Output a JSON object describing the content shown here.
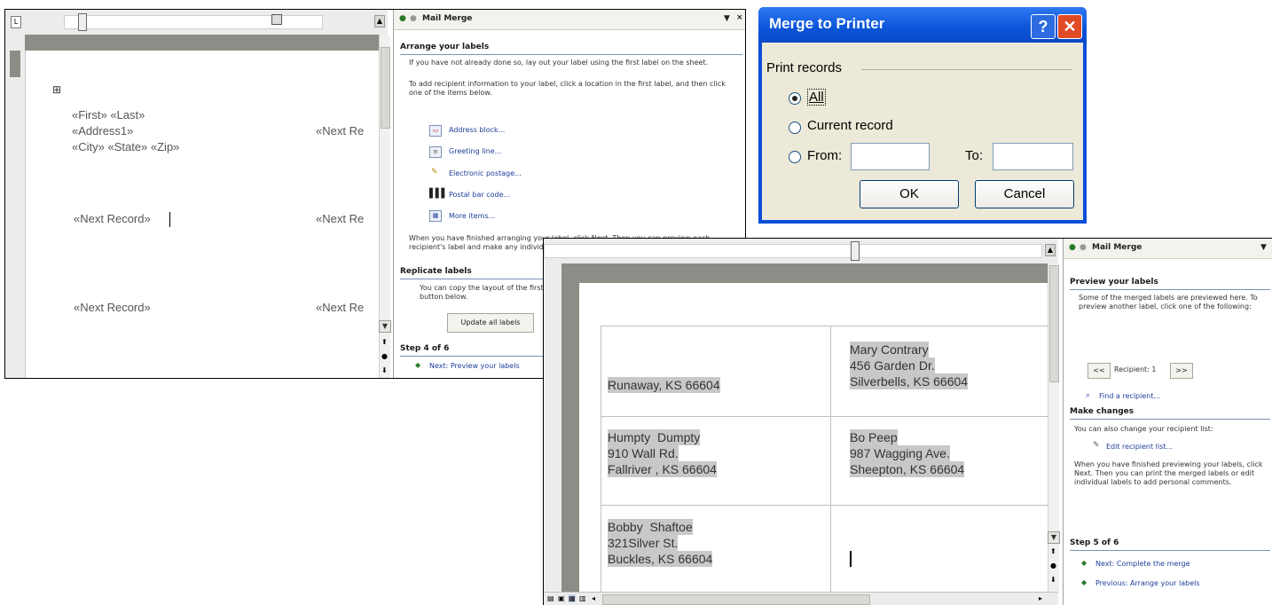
{
  "window1": {
    "taskpane": {
      "title": "Mail Merge",
      "section1_title": "Arrange your labels",
      "para1": "If you have not already done so, lay out your label using the first label on the sheet.",
      "para2": "To add recipient information to your label, click a location in the first label, and then click one of the items below.",
      "links": [
        "Address block...",
        "Greeting line...",
        "Electronic postage...",
        "Postal bar code...",
        "More items..."
      ],
      "para3": "When you have finished arranging your label, click Next. Then you can preview each recipient's label and make any individual changes.",
      "section2_title": "Replicate labels",
      "para4": "You can copy the layout of the first label to the other labels on the page by clicking the button below.",
      "update_button": "Update all labels",
      "step": "Step 4 of 6",
      "next_link": "Next: Preview your labels"
    },
    "doc": {
      "table_handle": "⊞",
      "label1_line1": "«First» «Last»",
      "label1_line2": "«Address1»",
      "label1_line3": "«City» «State» «Zip»",
      "next_record": "«Next Record»",
      "next_record_cut": "«Next Re"
    }
  },
  "dialog": {
    "title": "Merge to Printer",
    "help": "?",
    "close": "✕",
    "group_label": "Print records",
    "all": "All",
    "current": "Current record",
    "from": "From:",
    "to": "To:",
    "from_value": "",
    "to_value": "",
    "ok": "OK",
    "cancel": "Cancel"
  },
  "window2": {
    "taskpane": {
      "title": "Mail Merge",
      "section1_title": "Preview your labels",
      "para1": "Some of the merged labels are previewed here. To preview another label, click one of the following:",
      "prev_btn": "<<",
      "recipient": "Recipient: 1",
      "next_btn": ">>",
      "find_link": "Find a recipient...",
      "section2_title": "Make changes",
      "para2": "You can also change your recipient list:",
      "edit_link": "Edit recipient list...",
      "para3": "When you have finished previewing your labels, click Next. Then you can print the merged labels or edit individual labels to add personal comments.",
      "step": "Step 5 of 6",
      "next_link": "Next: Complete the merge",
      "prev_link": "Previous: Arrange your labels"
    },
    "labels": {
      "r1c1": "Runaway, KS 66604",
      "r1c2_l1": "Mary Contrary",
      "r1c2_l2": "456 Garden Dr.",
      "r1c2_l3": "Silverbells, KS 66604",
      "r2c1_l1": "Humpty  Dumpty",
      "r2c1_l2": "910 Wall Rd.",
      "r2c1_l3": "Fallriver , KS 66604",
      "r2c2_l1": "Bo Peep",
      "r2c2_l2": "987 Wagging Ave.",
      "r2c2_l3": "Sheepton, KS 66604",
      "r3c1_l1": "Bobby  Shaftoe",
      "r3c1_l2": "321Silver St.",
      "r3c1_l3": "Buckles, KS 66604"
    }
  }
}
